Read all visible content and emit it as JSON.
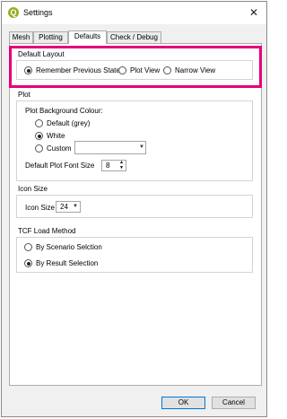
{
  "window": {
    "title": "Settings",
    "app_icon_letter": "Q"
  },
  "tabs": [
    {
      "label": "Mesh",
      "active": false
    },
    {
      "label": "Plotting",
      "active": false
    },
    {
      "label": "Defaults",
      "active": true
    },
    {
      "label": "Check / Debug",
      "active": false
    }
  ],
  "default_layout": {
    "title": "Default Layout",
    "options": [
      {
        "label": "Remember Previous State",
        "checked": true
      },
      {
        "label": "Plot View",
        "checked": false
      },
      {
        "label": "Narrow View",
        "checked": false
      }
    ]
  },
  "plot": {
    "title": "Plot",
    "background_label": "Plot Background Colour:",
    "background_options": [
      {
        "label": "Default (grey)",
        "checked": false
      },
      {
        "label": "White",
        "checked": true
      },
      {
        "label": "Custom",
        "checked": false
      }
    ],
    "font_size_label": "Default Plot Font Size",
    "font_size_value": "8"
  },
  "icon_size": {
    "title": "Icon Size",
    "label": "Icon Size",
    "value": "24"
  },
  "tcf_load": {
    "title": "TCF Load Method",
    "options": [
      {
        "label": "By Scenario Selction",
        "checked": false
      },
      {
        "label": "By Result Selection",
        "checked": true
      }
    ]
  },
  "buttons": {
    "ok": "OK",
    "cancel": "Cancel"
  },
  "colors": {
    "highlight": "#e4007c",
    "app_icon": "#93b023"
  }
}
